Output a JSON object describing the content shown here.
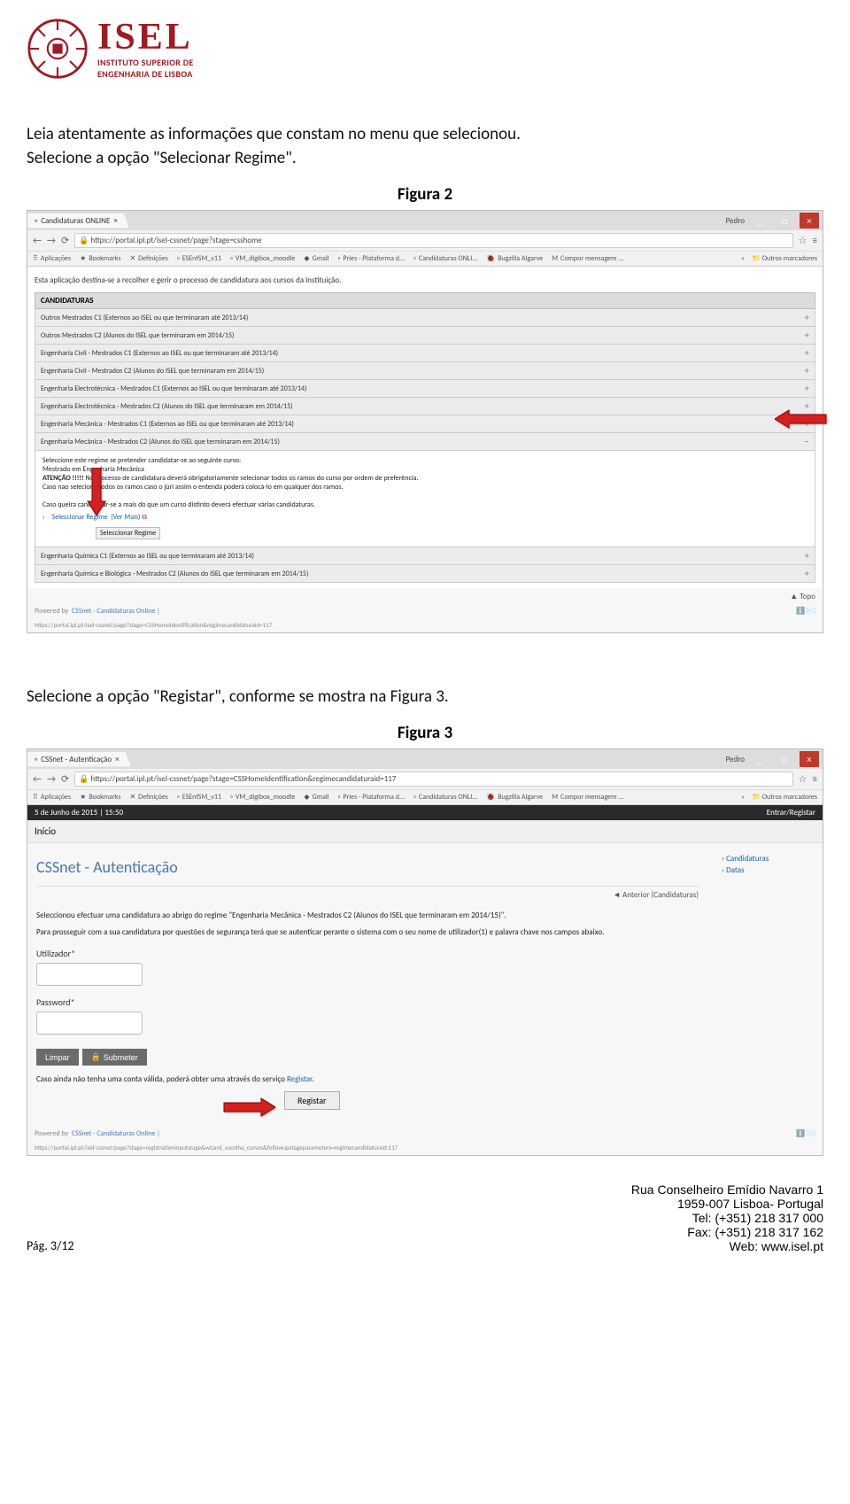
{
  "logo": {
    "acronym": "ISEL",
    "line1": "INSTITUTO SUPERIOR DE",
    "line2": "ENGENHARIA DE LISBOA"
  },
  "body": {
    "p1": "Leia atentamente as informações que constam no menu que selecionou.",
    "p2": "Selecione a opção \"Selecionar Regime\".",
    "fig2": "Figura 2",
    "p3": "Selecione a opção \"Registar\", conforme se mostra na Figura 3.",
    "fig3": "Figura 3"
  },
  "screenshot1": {
    "tab": "Candidaturas ONLINE",
    "user": "Pedro",
    "url": "https://portal.ipl.pt/isel-cssnet/page?stage=csshome",
    "bookmarks": [
      "Aplicações",
      "Bookmarks",
      "Definições",
      "ESEnfSM_v11",
      "VM_digibox_moodle",
      "Gmail",
      "Pries - Plataforma d...",
      "Candidaturas ONLI...",
      "Bugzilla Algarve",
      "Compor mensagem ..."
    ],
    "bm_more": "»",
    "bm_other": "Outros marcadores",
    "intro": "Esta aplicação destina-se a recolher e gerir o processo de candidatura aos cursos da Instituição.",
    "header": "CANDIDATURAS",
    "rows": [
      "Outros Mestrados C1 (Externos ao ISEL ou que terminaram até 2013/14)",
      "Outros Mestrados C2 (Alunos do ISEL que terminaram em 2014/15)",
      "Engenharia Civil - Mestrados C1 (Externos ao ISEL ou que terminaram até 2013/14)",
      "Engenharia Civil - Mestrados C2 (Alunos do ISEL que terminaram em 2014/15)",
      "Engenharia Electrotécnica - Mestrados C1 (Externos ao ISEL ou que terminaram até 2013/14)",
      "Engenharia Electrotécnica - Mestrados C2 (Alunos do ISEL que terminaram em 2014/15)",
      "Engenharia Mecânica - Mestrados C1 (Externos ao ISEL ou que terminaram até 2013/14)",
      "Engenharia Mecânica - Mestrados C2 (Alunos do ISEL que terminaram em 2014/15)"
    ],
    "sub": {
      "l1": "Seleccione este regime se pretender candidatar-se ao seguinte curso:",
      "l2": "Mestrado em Engenharia Mecânica",
      "l3a": "ATENÇÃO !!!!!",
      "l3b": " No processo de candidatura deverá obrigatoriamente selecionar todos os ramos do curso por ordem de preferência.",
      "l4": "Caso nao selecione todos os ramos caso o júri assim o entenda poderá colocá-lo em qualquer dos ramos.",
      "l5": "Caso queira candidatar-se a mais do que um curso distinto deverá efectuar várias candidaturas.",
      "sel": "Seleccionar Regime",
      "ver": "(Ver Mais)",
      "tooltip": "Seleccionar Regime"
    },
    "rows2": [
      "Engenharia Química                                     C1 (Externos ao ISEL ou que terminaram até 2013/14)",
      "Engenharia Química e Biológica - Mestrados C2 (Alunos do ISEL que terminaram em 2014/15)"
    ],
    "topo": "Topo",
    "powered": "Powered by",
    "cssnet": "CSSnet - Candidaturas Online |",
    "footer_url": "https://portal.ipl.pt/isel-cssnet/page?stage=CSSHomeIdentification&regimecandidaturaid=117"
  },
  "screenshot2": {
    "tab": "CSSnet - Autenticação",
    "user": "Pedro",
    "url": "https://portal.ipl.pt/isel-cssnet/page?stage=CSSHomeIdentification&regimecandidaturaid=117",
    "datebar_left": "5 de Junho de 2015 | 15:50",
    "datebar_right": "Entrar/Registar",
    "inicio": "Início",
    "title": "CSSnet - Autenticação",
    "side_links": [
      "Candidaturas",
      "Datas"
    ],
    "anterior": "Anterior (Candidaturas)",
    "desc1": "Seleccionou efectuar uma candidatura ao abrigo do regime \"Engenharia Mecânica - Mestrados C2 (Alunos do ISEL que terminaram em 2014/15)\".",
    "desc2": "Para prosseguir com a sua candidatura por questões de segurança terá que se autenticar perante o sistema com o seu nome de utilizador(1) e palavra chave nos campos abaixo.",
    "label_user": "Utilizador*",
    "label_pass": "Password*",
    "btn_limpar": "Limpar",
    "btn_submeter": "Submeter",
    "reg_note_a": "Caso ainda não tenha uma conta válida, poderá obter uma através do serviço ",
    "reg_note_b": "Registar",
    "reg_note_c": ".",
    "btn_registar": "Registar",
    "powered": "Powered by",
    "cssnet": "CSSnet - Candidaturas Online |",
    "footer_url": "https://portal.ipl.pt/isel-cssnet/page?stage=registrationinputstage&wizard_escolha_cursos&followupstageparameters=regimecandidaturaid:117"
  },
  "footer": {
    "page": "Pág. 3/12",
    "addr1": "Rua Conselheiro Emídio Navarro 1",
    "addr2": "1959-007 Lisboa- Portugal",
    "tel": "Tel: (+351) 218 317 000",
    "fax": "Fax: (+351) 218 317 162",
    "web": "Web: www.isel.pt"
  }
}
